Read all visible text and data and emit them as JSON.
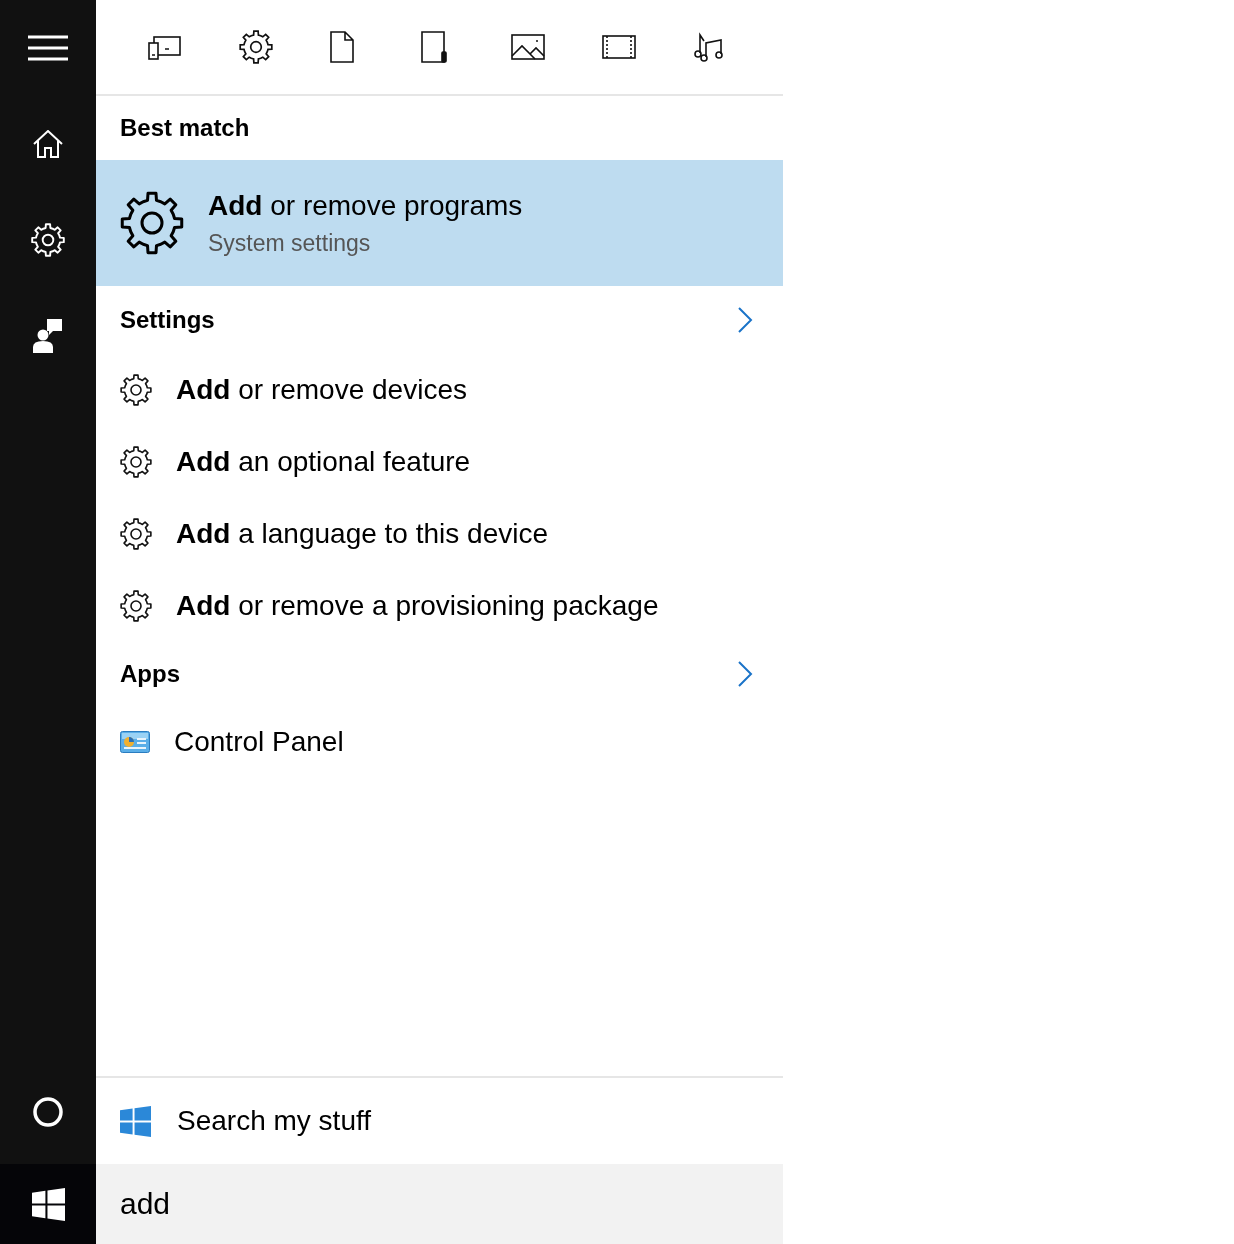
{
  "best_match": {
    "header": "Best match",
    "title": "**Add** or remove programs",
    "subtitle": "System settings",
    "selected": true
  },
  "sections": [
    {
      "header": "Settings",
      "items": [
        {
          "kind": "setting",
          "title": "**Add** or remove devices"
        },
        {
          "kind": "setting",
          "title": "**Add** an optional feature"
        },
        {
          "kind": "setting",
          "title": "**Add** a language to this device"
        },
        {
          "kind": "setting",
          "title": "**Add** or remove a provisioning package"
        }
      ]
    },
    {
      "header": "Apps",
      "items": [
        {
          "kind": "app",
          "title": "Control Panel"
        }
      ]
    }
  ],
  "search_my_stuff": "Search my stuff",
  "search_box": {
    "value": "add"
  }
}
